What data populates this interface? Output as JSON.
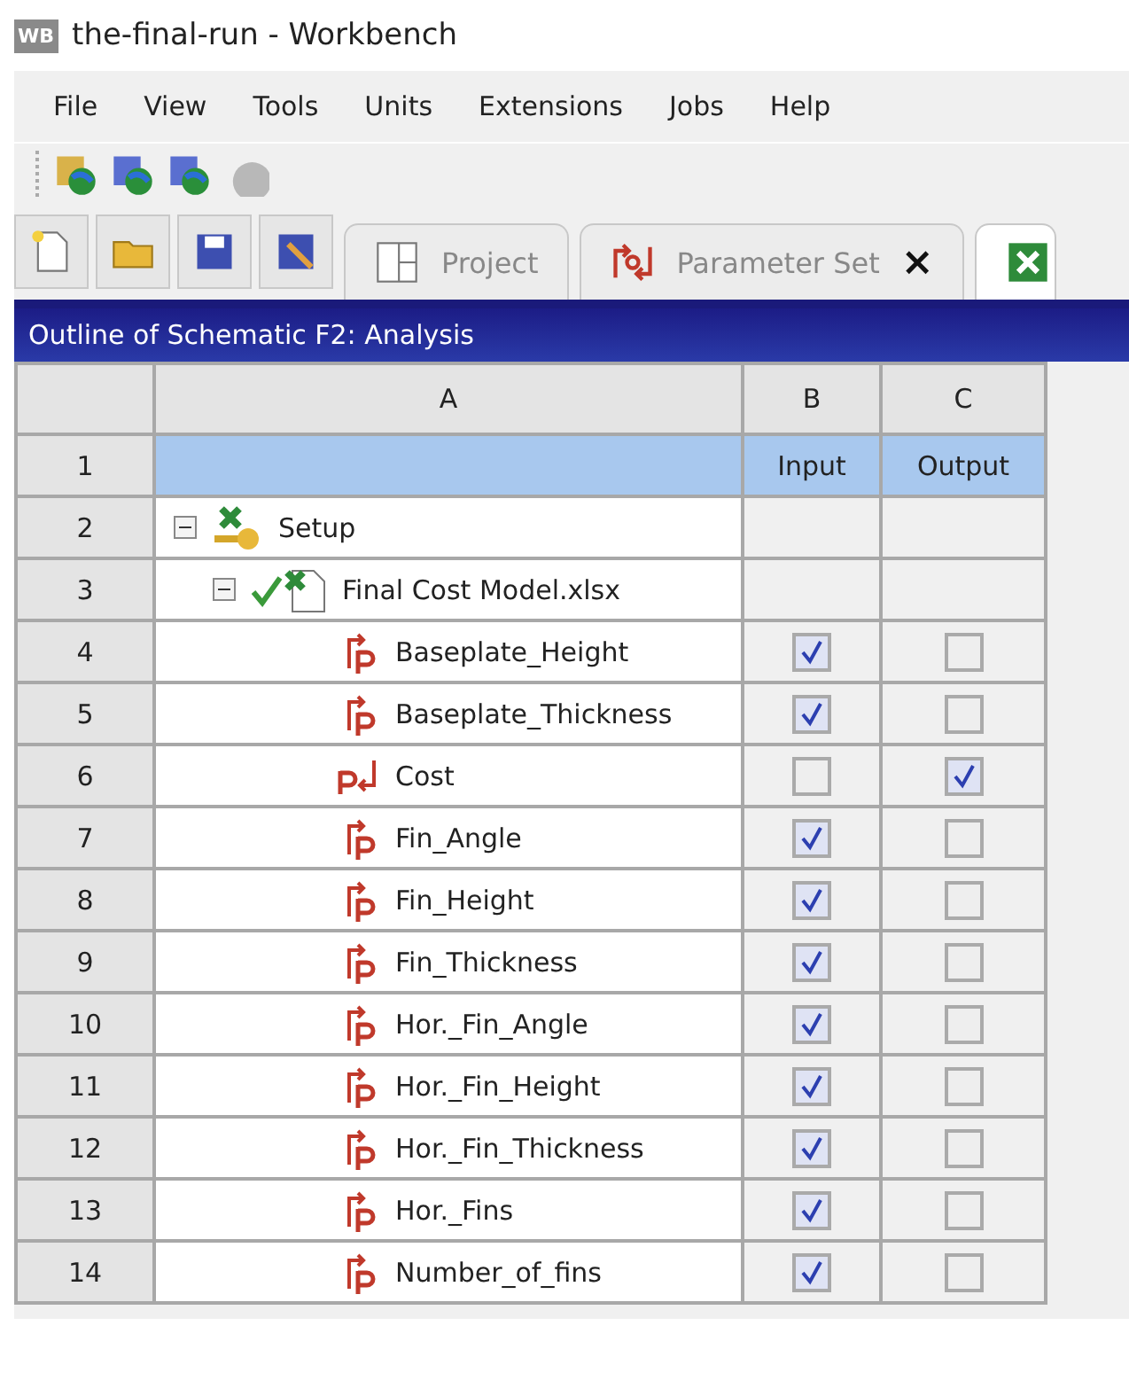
{
  "window": {
    "app_badge": "WB",
    "title": "the-final-run - Workbench"
  },
  "menu": [
    "File",
    "View",
    "Tools",
    "Units",
    "Extensions",
    "Jobs",
    "Help"
  ],
  "web_toolbar": [
    {
      "disabled": false
    },
    {
      "disabled": false
    },
    {
      "disabled": false
    },
    {
      "disabled": true
    }
  ],
  "tabs": [
    {
      "kind": "project",
      "label": "Project",
      "selected": false
    },
    {
      "kind": "parameters",
      "label": "Parameter Set",
      "close": "×",
      "selected": false
    },
    {
      "kind": "excel",
      "selected": true
    }
  ],
  "outline": {
    "title": "Outline of Schematic F2: Analysis",
    "columns": [
      "A",
      "B",
      "C"
    ],
    "header_row": {
      "num": "1",
      "input": "Input",
      "output": "Output"
    },
    "tree": [
      {
        "num": "2",
        "label": "Setup",
        "kind": "system",
        "expanded": true,
        "children": [
          {
            "num": "3",
            "label": "Final Cost Model.xlsx",
            "kind": "file",
            "expanded": true,
            "children": [
              {
                "num": "4",
                "label": "Baseplate_Height",
                "kind": "input_param",
                "input": true,
                "output": false
              },
              {
                "num": "5",
                "label": "Baseplate_Thickness",
                "kind": "input_param",
                "input": true,
                "output": false
              },
              {
                "num": "6",
                "label": "Cost",
                "kind": "output_param",
                "input": false,
                "output": true
              },
              {
                "num": "7",
                "label": "Fin_Angle",
                "kind": "input_param",
                "input": true,
                "output": false
              },
              {
                "num": "8",
                "label": "Fin_Height",
                "kind": "input_param",
                "input": true,
                "output": false
              },
              {
                "num": "9",
                "label": "Fin_Thickness",
                "kind": "input_param",
                "input": true,
                "output": false
              },
              {
                "num": "10",
                "label": "Hor._Fin_Angle",
                "kind": "input_param",
                "input": true,
                "output": false
              },
              {
                "num": "11",
                "label": "Hor._Fin_Height",
                "kind": "input_param",
                "input": true,
                "output": false
              },
              {
                "num": "12",
                "label": "Hor._Fin_Thickness",
                "kind": "input_param",
                "input": true,
                "output": false
              },
              {
                "num": "13",
                "label": "Hor._Fins",
                "kind": "input_param",
                "input": true,
                "output": false
              },
              {
                "num": "14",
                "label": "Number_of_fins",
                "kind": "input_param",
                "input": true,
                "output": false
              }
            ]
          }
        ]
      }
    ]
  }
}
